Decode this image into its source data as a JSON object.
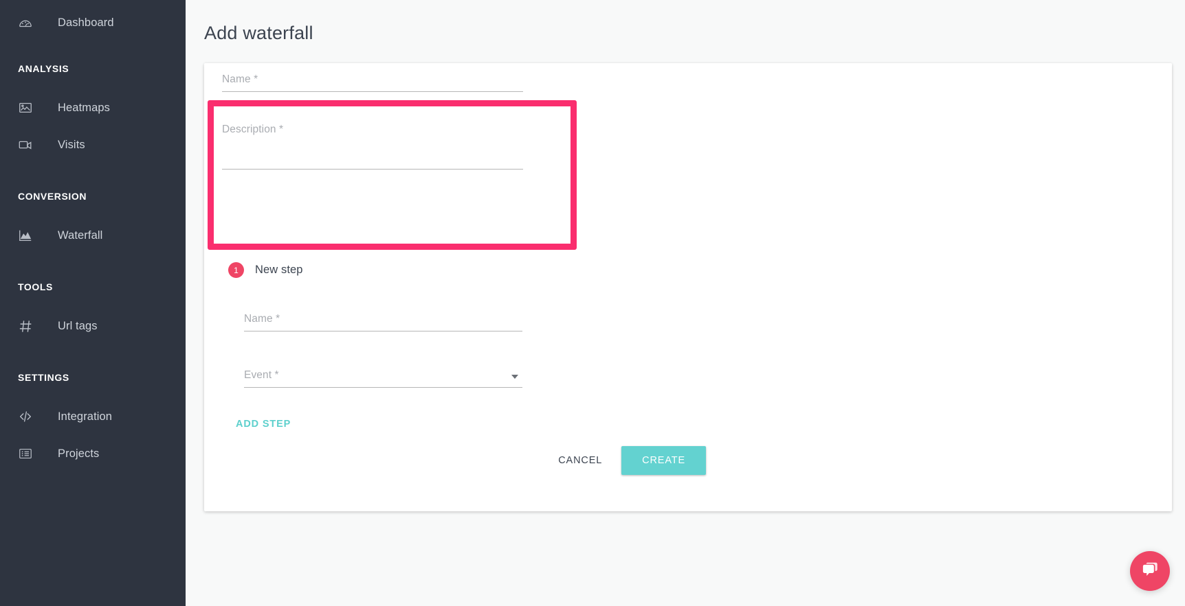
{
  "sidebar": {
    "items": [
      {
        "label": "Dashboard",
        "icon": "gauge-icon",
        "type": "item",
        "key": "dashboard"
      },
      {
        "label": "ANALYSIS",
        "type": "section",
        "key": "analysis"
      },
      {
        "label": "Heatmaps",
        "icon": "heatmap-image-icon",
        "type": "item",
        "key": "heatmaps"
      },
      {
        "label": "Visits",
        "icon": "video-camera-icon",
        "type": "item",
        "key": "visits"
      },
      {
        "label": "CONVERSION",
        "type": "section",
        "key": "conversion"
      },
      {
        "label": "Waterfall",
        "icon": "area-chart-icon",
        "type": "item",
        "key": "waterfall"
      },
      {
        "label": "TOOLS",
        "type": "section",
        "key": "tools"
      },
      {
        "label": "Url tags",
        "icon": "hash-icon",
        "type": "item",
        "key": "url-tags"
      },
      {
        "label": "SETTINGS",
        "type": "section",
        "key": "settings"
      },
      {
        "label": "Integration",
        "icon": "code-brackets-icon",
        "type": "item",
        "key": "integration"
      },
      {
        "label": "Projects",
        "icon": "list-icon",
        "type": "item",
        "key": "projects"
      }
    ]
  },
  "header": {
    "title": "Add waterfall"
  },
  "form": {
    "name": {
      "placeholder": "Name *",
      "value": ""
    },
    "description": {
      "placeholder": "Description *",
      "value": ""
    }
  },
  "step": {
    "badge": "1",
    "title": "New step",
    "name": {
      "placeholder": "Name *",
      "value": ""
    },
    "event": {
      "placeholder": "Event *",
      "value": ""
    },
    "add_step_label": "ADD STEP"
  },
  "actions": {
    "cancel_label": "CANCEL",
    "create_label": "CREATE"
  },
  "chat": {
    "icon": "chat-bubbles-icon"
  },
  "colors": {
    "highlight": "#fa2e6e",
    "sidebar_bg": "#2e3440",
    "accent_teal": "#63d2d0",
    "accent_pink": "#ef4565",
    "page_bg": "#f8f9f9",
    "card_bg": "#ffffff"
  }
}
